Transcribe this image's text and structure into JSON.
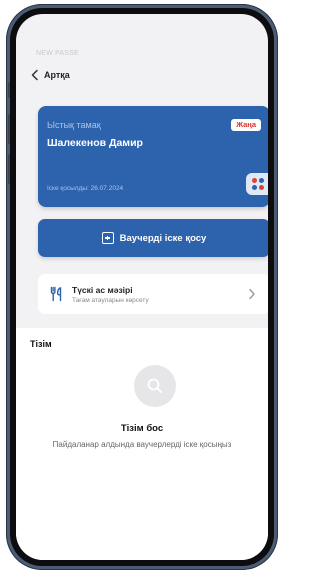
{
  "status_bar": {
    "faint_text": "NEW PASSE"
  },
  "header": {
    "back_label": "Артқа"
  },
  "voucher_card": {
    "type_label": "Ыстық тамақ",
    "holder_name": "Шалекенов Дамир",
    "activation_date": "Іске қосылды: 26.07.2024",
    "badge": "Жаңа",
    "app_icon": "app-grid-icon",
    "colors": {
      "card_bg": "#2d62ad",
      "badge_text": "#d9302b"
    }
  },
  "activate_button": {
    "label": "Ваучерді іске қосу",
    "icon": "plus-square-icon"
  },
  "menu": {
    "title": "Түскі ас мәзірі",
    "subtitle": "Тағам атауларын көрсету",
    "icon": "cutlery-icon",
    "chevron": "chevron-right-icon"
  },
  "list": {
    "title": "Тізім",
    "empty_icon": "search-icon",
    "empty_title": "Тізім бос",
    "empty_subtitle": "Пайдаланар алдында ваучерлерді іске қосыңыз"
  }
}
